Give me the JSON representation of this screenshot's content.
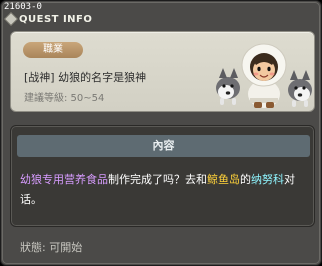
{
  "window": {
    "quest_id": "21603-0",
    "title": "QUEST INFO"
  },
  "quest": {
    "job_badge": "職業",
    "name": "[战神] 幼狼的名字是狼神",
    "recommended_level": "建議等級: 50~54"
  },
  "content": {
    "header": "內容",
    "segments": [
      {
        "text": "幼狼专用营养食品",
        "color": "purple"
      },
      {
        "text": "制作完成了吗？去和",
        "color": "white"
      },
      {
        "text": "鲸鱼岛",
        "color": "yellow"
      },
      {
        "text": "的",
        "color": "white"
      },
      {
        "text": "纳努科",
        "color": "cyan"
      },
      {
        "text": "对话。",
        "color": "white"
      }
    ]
  },
  "status": {
    "text": "狀態:  可開始"
  },
  "colors": {
    "purple": "#d79cff",
    "yellow": "#ffd23a",
    "cyan": "#8ff5ff",
    "white": "#ffffff"
  },
  "icons": {
    "npc_portrait": "child-with-sled-dogs"
  }
}
